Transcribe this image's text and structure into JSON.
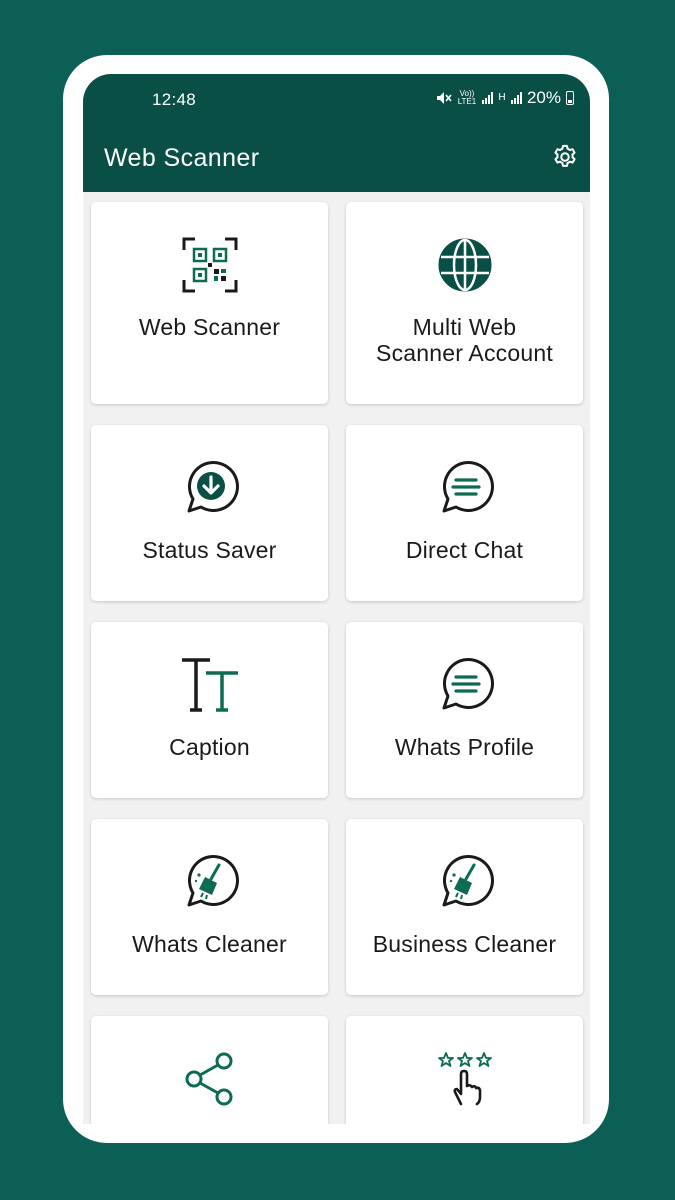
{
  "status_bar": {
    "time": "12:48",
    "volte_label": "Vo)) LTE1",
    "network_label": "H",
    "battery": "20%"
  },
  "app_bar": {
    "title": "Web Scanner",
    "settings_icon": "gear-icon"
  },
  "colors": {
    "background": "#0b5f55",
    "app_bar": "#0a4f45",
    "icon_accent": "#0d6b52",
    "icon_dark": "#1a1a1a"
  },
  "menu": [
    {
      "label": "Web Scanner",
      "icon": "qr-scan-icon"
    },
    {
      "label": "Multi Web\nScanner Account",
      "icon": "globe-icon"
    },
    {
      "label": "Status Saver",
      "icon": "chat-download-icon"
    },
    {
      "label": "Direct Chat",
      "icon": "chat-lines-icon"
    },
    {
      "label": "Caption",
      "icon": "text-caption-icon"
    },
    {
      "label": "Whats Profile",
      "icon": "chat-lines-icon"
    },
    {
      "label": "Whats Cleaner",
      "icon": "chat-broom-icon"
    },
    {
      "label": "Business Cleaner",
      "icon": "chat-broom-icon"
    },
    {
      "label": "",
      "icon": "share-icon"
    },
    {
      "label": "",
      "icon": "rate-stars-icon"
    }
  ]
}
